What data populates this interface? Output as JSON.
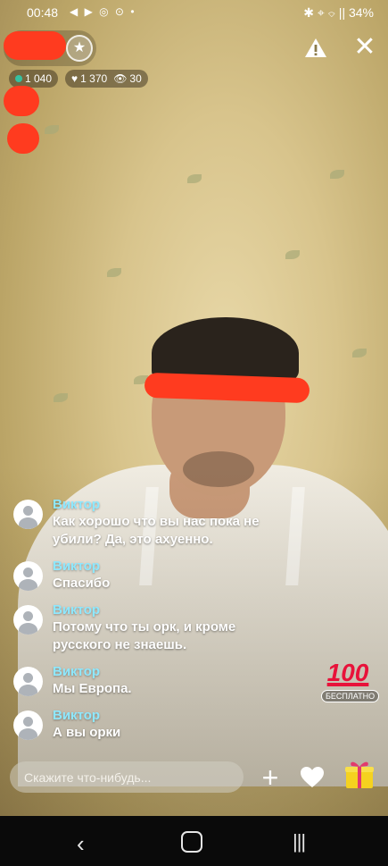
{
  "status_bar": {
    "time": "00:48",
    "left_icons": "◀ ▶ ◎ ⊙ •",
    "right_icons": "✱ ⌖ ⌔ ||",
    "battery": "34%"
  },
  "stream": {
    "viewers_online": "1 040",
    "likes": "1 370",
    "views": "30"
  },
  "chat": {
    "messages": [
      {
        "name": "Виктор",
        "text": "Как хорошо что вы нас пока не убили? Да, это ахуенно."
      },
      {
        "name": "Виктор",
        "text": "Спасибо"
      },
      {
        "name": "Виктор",
        "text": "Потому что ты орк, и кроме русского не знаешь."
      },
      {
        "name": "Виктор",
        "text": "Мы Европа."
      },
      {
        "name": "Виктор",
        "text": "А вы орки"
      }
    ]
  },
  "gift_badge": {
    "value": "100",
    "label": "БЕСПЛАТНО"
  },
  "input": {
    "placeholder": "Скажите что-нибудь..."
  },
  "icons": {
    "star": "star-icon",
    "warning": "warning-icon",
    "close": "close-icon",
    "plus": "plus-icon",
    "heart": "heart-icon",
    "gift": "gift-icon"
  },
  "colors": {
    "chat_name": "#8ee8ff",
    "redaction": "#ff3b1f",
    "badge_red": "#e8123a",
    "gift_yellow": "#f5d21f"
  }
}
